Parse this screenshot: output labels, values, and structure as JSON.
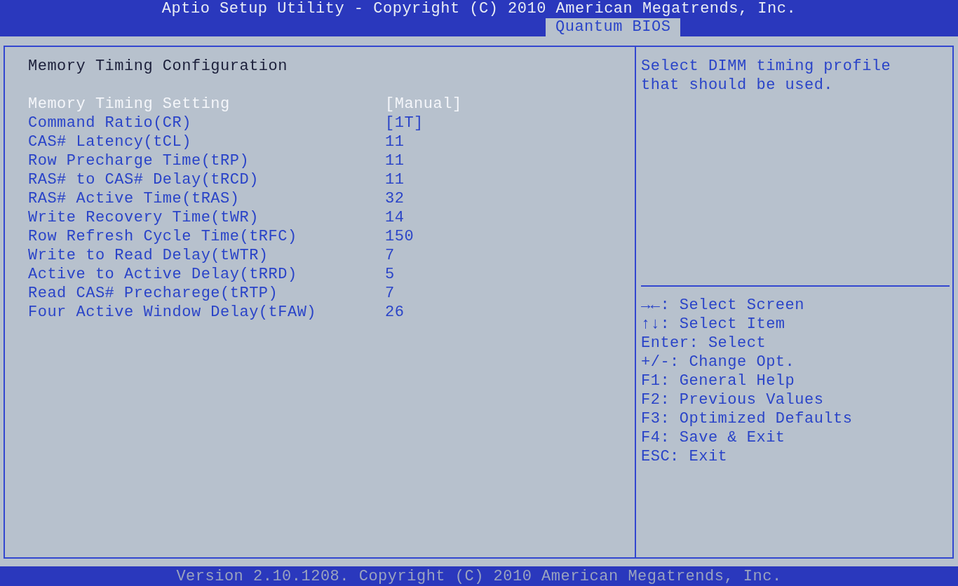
{
  "header": {
    "title": "Aptio Setup Utility - Copyright (C) 2010 American Megatrends, Inc.",
    "tabs": [
      {
        "label": "Quantum BIOS",
        "selected": true
      }
    ]
  },
  "settings": {
    "title": "Memory Timing Configuration",
    "items": [
      {
        "label": "Memory Timing Setting",
        "value": "[Manual]",
        "selected": true
      },
      {
        "label": "Command Ratio(CR)",
        "value": "[1T]",
        "selected": false
      },
      {
        "label": "CAS# Latency(tCL)",
        "value": "11",
        "selected": false
      },
      {
        "label": "Row Precharge Time(tRP)",
        "value": "11",
        "selected": false
      },
      {
        "label": "RAS# to CAS# Delay(tRCD)",
        "value": "11",
        "selected": false
      },
      {
        "label": "RAS# Active Time(tRAS)",
        "value": "32",
        "selected": false
      },
      {
        "label": "Write Recovery Time(tWR)",
        "value": "14",
        "selected": false
      },
      {
        "label": "Row Refresh Cycle Time(tRFC)",
        "value": "150",
        "selected": false
      },
      {
        "label": "Write to Read Delay(tWTR)",
        "value": "7",
        "selected": false
      },
      {
        "label": "Active to Active Delay(tRRD)",
        "value": "5",
        "selected": false
      },
      {
        "label": "Read CAS# Precharege(tRTP)",
        "value": "7",
        "selected": false
      },
      {
        "label": "Four Active Window Delay(tFAW)",
        "value": "26",
        "selected": false
      }
    ]
  },
  "help": {
    "text": "Select DIMM timing profile that should be used.",
    "keys": [
      "→←: Select Screen",
      "↑↓: Select Item",
      "Enter: Select",
      "+/-: Change Opt.",
      "F1: General Help",
      "F2: Previous Values",
      "F3: Optimized Defaults",
      "F4: Save & Exit",
      "ESC: Exit"
    ]
  },
  "status_bar": "Version 2.10.1208. Copyright (C) 2010 American Megatrends, Inc."
}
